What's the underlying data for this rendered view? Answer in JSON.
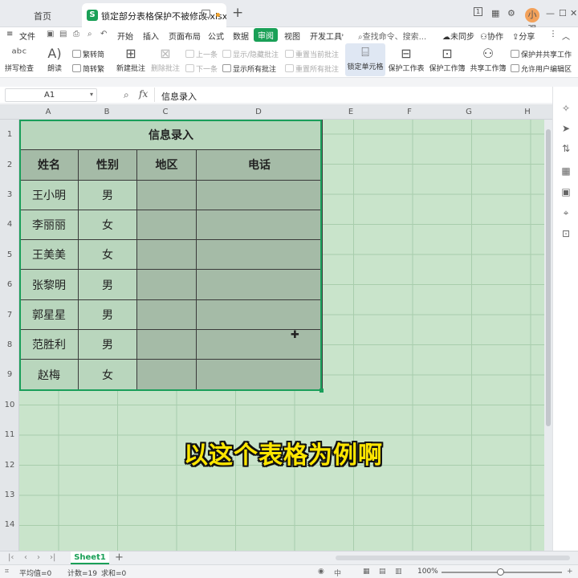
{
  "tabs": {
    "home": "首页",
    "active": "锁定部分表格保护不被修改.xlsx",
    "badge": "1",
    "avatar": "小强"
  },
  "menu": {
    "file": "文件",
    "items": [
      "开始",
      "插入",
      "页面布局",
      "公式",
      "数据",
      "审阅",
      "视图",
      "开发工具"
    ],
    "active": "审阅",
    "search": "查找命令、搜索...",
    "sync": "未同步",
    "collab": "协作",
    "share": "分享"
  },
  "ribbon": {
    "spellcheck": "拼写检查",
    "read": "朗读",
    "trad": "繁转简",
    "simp": "简转繁",
    "new_comment": "新建批注",
    "del_comment": "删除批注",
    "prev": "上一条",
    "next": "下一条",
    "show_hide": "显示/隐藏批注",
    "show_all": "显示所有批注",
    "reset_cur": "重置当前批注",
    "reset_all": "重置所有批注",
    "lock_cell": "锁定单元格",
    "protect_sheet": "保护工作表",
    "protect_book": "保护工作簿",
    "share_book": "共享工作簿",
    "protect_share": "保护并共享工作",
    "allow_edit": "允许用户编辑区"
  },
  "formula": {
    "cell_ref": "A1",
    "value": "信息录入"
  },
  "columns": [
    "A",
    "B",
    "C",
    "D",
    "E",
    "F",
    "G",
    "H"
  ],
  "rows": [
    "1",
    "2",
    "3",
    "4",
    "5",
    "6",
    "7",
    "8",
    "9",
    "10",
    "11",
    "12",
    "13",
    "14"
  ],
  "table": {
    "title": "信息录入",
    "headers": [
      "姓名",
      "性别",
      "地区",
      "电话"
    ],
    "data": [
      [
        "王小明",
        "男"
      ],
      [
        "李丽丽",
        "女"
      ],
      [
        "王美美",
        "女"
      ],
      [
        "张黎明",
        "男"
      ],
      [
        "郭星星",
        "男"
      ],
      [
        "范胜利",
        "男"
      ],
      [
        "赵梅",
        "女"
      ]
    ]
  },
  "caption": "以这个表格为例啊",
  "sheet": {
    "name": "Sheet1"
  },
  "status": {
    "avg": "平均值=0",
    "count": "计数=19",
    "sum": "求和=0",
    "zoom": "100%"
  },
  "colors": {
    "accent": "#1aa057",
    "sheet_bg": "#c9e4cb",
    "caption": "#ffe600"
  }
}
